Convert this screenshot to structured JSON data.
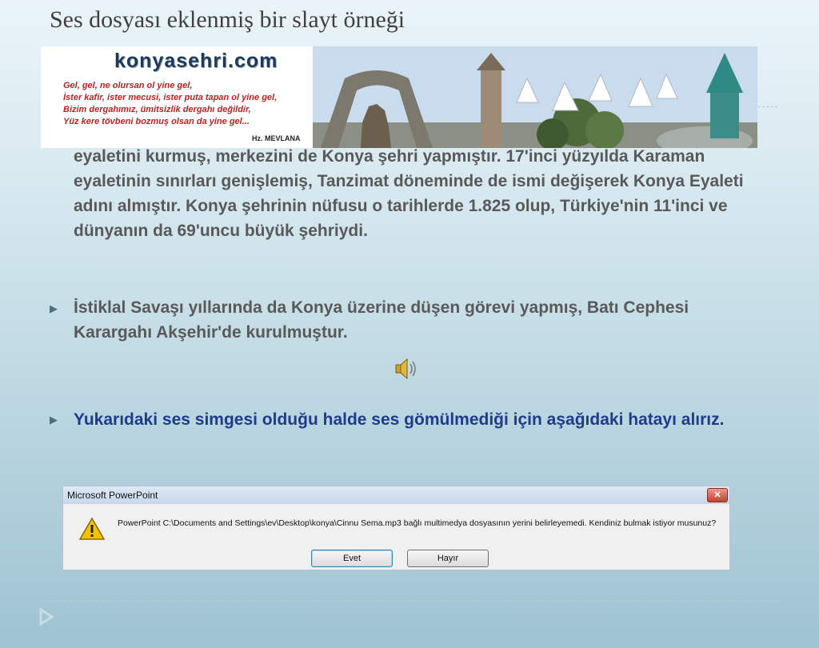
{
  "slide": {
    "title": "Ses dosyası eklenmiş bir slayt örneği",
    "paragraph1": "eyaletini kurmuş, merkezini de Konya şehri yapmıştır. 17'inci yüzyılda Karaman eyaletinin sınırları genişlemiş, Tanzimat döneminde de ismi değişerek Konya Eyaleti adını almıştır. Konya şehrinin nüfusu o tarihlerde 1.825 olup, Türkiye'nin 11'inci ve dünyanın da 69'uncu büyük şehriydi.",
    "bullet2": "İstiklal Savaşı yıllarında da Konya üzerine düşen görevi yapmış, Batı Cephesi Karargahı Akşehir'de kurulmuştur.",
    "bullet3": "Yukarıdaki ses simgesi olduğu halde ses gömülmediği için aşağıdaki hatayı alırız.",
    "bullet_glyph": "▶"
  },
  "banner": {
    "brand": "konyasehri.com",
    "poem_lines": [
      "Gel, gel, ne olursan ol yine gel,",
      "İster kafir, ister mecusi, ister puta tapan ol yine gel,",
      "Bizim dergahımız, ümitsizlik dergahı değildir,",
      "Yüz kere tövbeni bozmuş olsan da yine gel..."
    ],
    "signature": "Hz. MEVLANA"
  },
  "icons": {
    "speaker": "speaker-icon",
    "warning": "warning-icon",
    "next": "next-slide-icon"
  },
  "dialog": {
    "title": "Microsoft PowerPoint",
    "close_label": "✕",
    "message": "PowerPoint C:\\Documents and Settings\\ev\\Desktop\\konya\\Cinnu Sema.mp3 bağlı multimedya dosyasının yerini belirleyemedi. Kendiniz bulmak istiyor musunuz?",
    "yes_label": "Evet",
    "no_label": "Hayır"
  },
  "colors": {
    "title": "#404040",
    "body_text": "#595959",
    "highlight_text": "#1f3b8c",
    "bullet": "#4a6f80"
  }
}
